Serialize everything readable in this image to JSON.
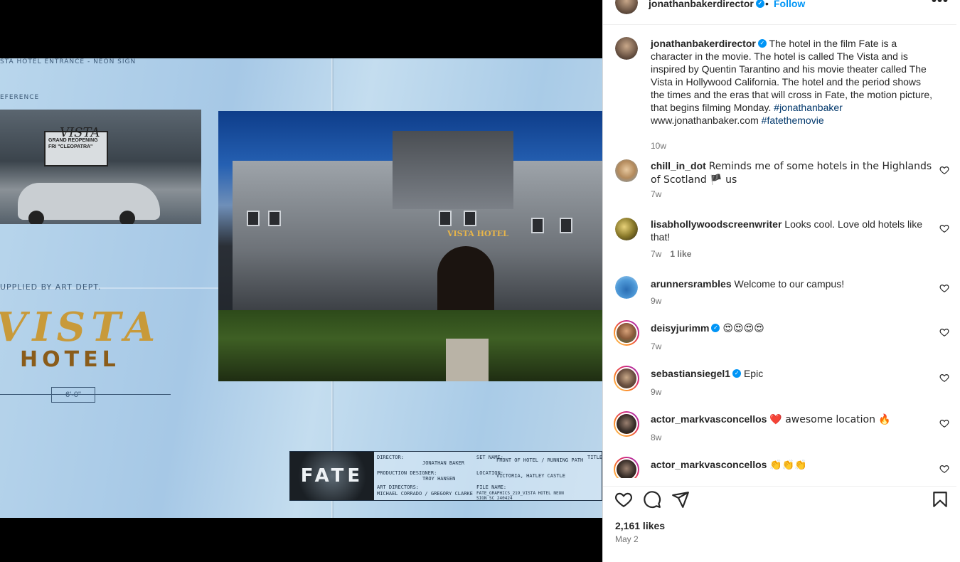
{
  "media": {
    "top_left_label": "STA HOTEL ENTRANCE - NEON SIGN",
    "reference_label": "EFERENCE",
    "ref_marquee_line1": "GRAND REOPENING",
    "ref_marquee_line2": "FRI \"CLEOPATRA\"",
    "ref_vista": "VISTA",
    "castle_sign": "VISTA HOTEL",
    "supplied": "UPPLIED BY ART DEPT.",
    "vista_logo": "VISTA",
    "hotel_logo": "HOTEL",
    "dimension": "6'-0\"",
    "title_block": {
      "fate": "FATE",
      "director_label": "DIRECTOR:",
      "director": "JONATHAN BAKER",
      "set_label": "SET NAME:",
      "set": "FRONT OF HOTEL / RUNNING PATH",
      "title_label": "TITLE:",
      "designer_label": "PRODUCTION DESIGNER:",
      "designer": "TROY HANSEN",
      "location_label": "LOCATION:",
      "location": "VICTORIA, HATLEY CASTLE",
      "art_label": "ART DIRECTORS:",
      "art": "MICHAEL CORRADO / GREGORY CLARKE",
      "file_label": "FILE NAME:",
      "file": "FATE_GRAPHICS_219_VISTA HOTEL NEON SIGN_SC_240424"
    }
  },
  "header": {
    "username": "jonathanbakerdirector",
    "dot": "•",
    "follow": "Follow",
    "more": "•••"
  },
  "caption": {
    "username": "jonathanbakerdirector",
    "text": "The hotel in the film Fate is a character in the movie. The hotel is called The Vista and is inspired by Quentin Tarantino and his movie theater called The Vista in Hollywood California. The hotel and the period shows the times and the eras that will cross in Fate, the motion picture, that begins filming Monday.",
    "hashtag1": "#jonathanbaker",
    "website": "www.jonathanbaker.com",
    "hashtag2": "#fatethemovie",
    "time": "10w"
  },
  "comments": [
    {
      "username": "chill_in_dot",
      "text": "Reminds me of some hotels in the Highlands of Scotland 🏴 us",
      "time": "7w",
      "likes": ""
    },
    {
      "username": "lisabhollywoodscreenwriter",
      "text": "Looks cool. Love old hotels like that!",
      "time": "7w",
      "likes": "1 like"
    },
    {
      "username": "arunnersrambles",
      "text": "Welcome to our campus!",
      "time": "9w",
      "likes": ""
    },
    {
      "username": "deisyjurimm",
      "text": "😍😍😍😍",
      "time": "7w",
      "likes": ""
    },
    {
      "username": "sebastiansiegel1",
      "text": "Epic",
      "time": "9w",
      "likes": ""
    },
    {
      "username": "actor_markvasconcellos",
      "text": "❤️ awesome location 🔥",
      "time": "8w",
      "likes": ""
    },
    {
      "username": "actor_markvasconcellos",
      "text": "👏👏👏",
      "time": "",
      "likes": ""
    }
  ],
  "footer": {
    "likes": "2,161 likes",
    "date": "May 2"
  },
  "colors": {
    "accent": "#0095f6",
    "link": "#00376b",
    "muted": "#737373"
  }
}
